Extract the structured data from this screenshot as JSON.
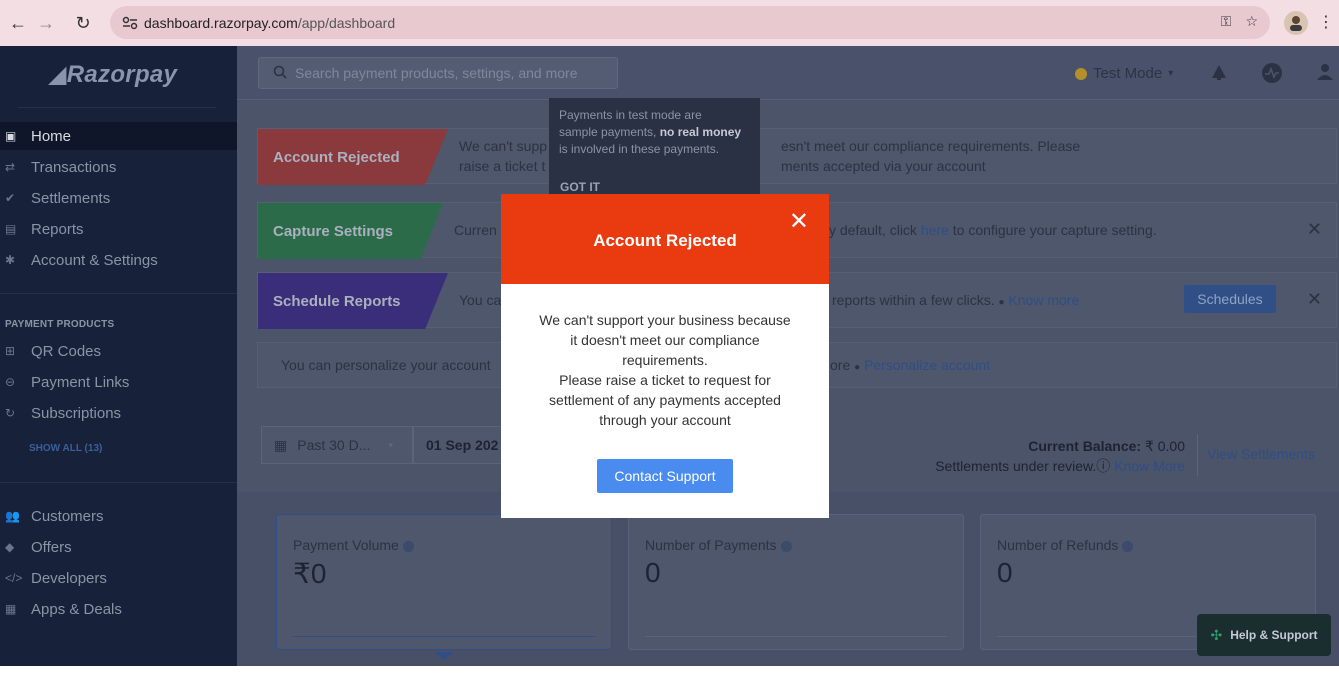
{
  "browser": {
    "url_host": "dashboard.razorpay.com",
    "url_path": "/app/dashboard"
  },
  "sidebar": {
    "logo": "Razorpay",
    "items": [
      {
        "label": "Home",
        "icon": "home-icon"
      },
      {
        "label": "Transactions",
        "icon": "transactions-icon"
      },
      {
        "label": "Settlements",
        "icon": "settlements-icon"
      },
      {
        "label": "Reports",
        "icon": "reports-icon"
      },
      {
        "label": "Account & Settings",
        "icon": "gear-icon"
      }
    ],
    "section_heading": "PAYMENT PRODUCTS",
    "products": [
      {
        "label": "QR Codes",
        "icon": "qr-icon"
      },
      {
        "label": "Payment Links",
        "icon": "link-icon"
      },
      {
        "label": "Subscriptions",
        "icon": "subscription-icon"
      }
    ],
    "show_all": "SHOW ALL (13)",
    "more": [
      {
        "label": "Customers",
        "icon": "customers-icon"
      },
      {
        "label": "Offers",
        "icon": "offers-icon"
      },
      {
        "label": "Developers",
        "icon": "code-icon"
      },
      {
        "label": "Apps & Deals",
        "icon": "apps-icon"
      }
    ]
  },
  "topbar": {
    "search_placeholder": "Search payment products, settings, and more",
    "test_mode": "Test Mode"
  },
  "tooltip": {
    "line1": "Payments in test mode are",
    "line2a": "sample payments, ",
    "line2b": "no real money",
    "line3": "is involved in these payments.",
    "got_it": "GOT IT"
  },
  "banners": {
    "rejected": {
      "tag": "Account Rejected",
      "text1": "We can't supp",
      "text1b": "esn't meet our compliance requirements. Please",
      "text2": "raise a ticket t",
      "text2b": "ments accepted via your account"
    },
    "capture": {
      "tag": "Capture Settings",
      "text": "Curren",
      "text_b": "y default, click ",
      "link": "here",
      "text_c": " to configure your capture setting."
    },
    "schedule": {
      "tag": "Schedule Reports",
      "text": "You ca",
      "text_b": "reports within a few clicks.",
      "link": "Know more",
      "button": "Schedules"
    },
    "personalize": {
      "text": "You can personalize your account",
      "text_b": "ore",
      "link": "Personalize account"
    }
  },
  "filters": {
    "range": "Past 30 D...",
    "date": "01 Sep 202"
  },
  "balance": {
    "label": "Current Balance:",
    "value": "₹ 0.00",
    "review": "Settlements under review.",
    "know_more": "Know More",
    "view_settlements": "View Settlements"
  },
  "stats": [
    {
      "label": "Payment Volume",
      "value": "₹0"
    },
    {
      "label": "Number of Payments",
      "value": "0"
    },
    {
      "label": "Number of Refunds",
      "value": "0"
    }
  ],
  "help": "Help & Support",
  "modal": {
    "title": "Account Rejected",
    "body_lines": [
      "We can't support your business because",
      "it doesn't meet our compliance",
      "requirements.",
      "Please raise a ticket to request for",
      "settlement of any payments accepted",
      "through your account"
    ],
    "button": "Contact Support"
  }
}
